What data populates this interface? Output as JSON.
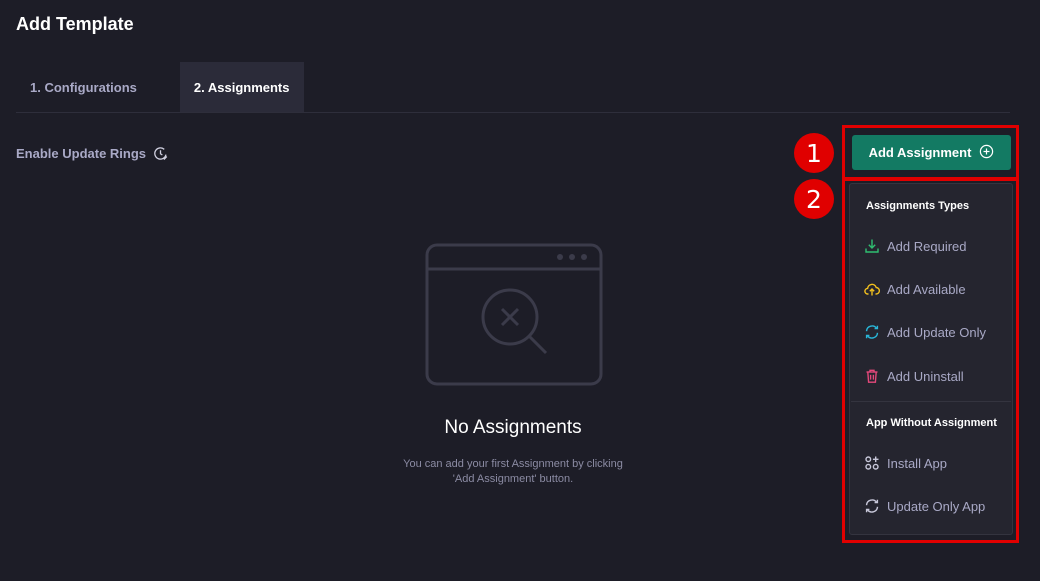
{
  "page": {
    "title": "Add Template"
  },
  "tabs": [
    {
      "label": "1. Configurations",
      "active": false
    },
    {
      "label": "2. Assignments",
      "active": true
    }
  ],
  "update_rings": {
    "label": "Enable Update Rings",
    "icon": "clock-check-icon"
  },
  "empty_state": {
    "icon": "browser-search-x-icon",
    "title": "No Assignments",
    "description": "You can add your first Assignment by clicking 'Add Assignment' button."
  },
  "toolbar": {
    "add_assignment_label": "Add Assignment",
    "add_icon": "plus-circle-icon"
  },
  "markers": [
    "1",
    "2"
  ],
  "menu": {
    "sections": [
      {
        "heading": "Assignments Types",
        "items": [
          {
            "label": "Add Required",
            "icon": "download-icon",
            "color": "#2fbf71"
          },
          {
            "label": "Add Available",
            "icon": "cloud-upload-icon",
            "color": "#f2c01e"
          },
          {
            "label": "Add Update Only",
            "icon": "refresh-icon",
            "color": "#29b6d8"
          },
          {
            "label": "Add Uninstall",
            "icon": "trash-icon",
            "color": "#e5487b"
          }
        ]
      },
      {
        "heading": "App Without Assignment",
        "items": [
          {
            "label": "Install App",
            "icon": "apps-add-icon",
            "color": "#a9a9c6"
          },
          {
            "label": "Update Only App",
            "icon": "refresh-icon",
            "color": "#a9a9c6"
          }
        ]
      }
    ]
  },
  "colors": {
    "background": "#1d1d27",
    "accent": "#137a63",
    "annotation": "#e00000",
    "menu_bg": "#25252f"
  }
}
